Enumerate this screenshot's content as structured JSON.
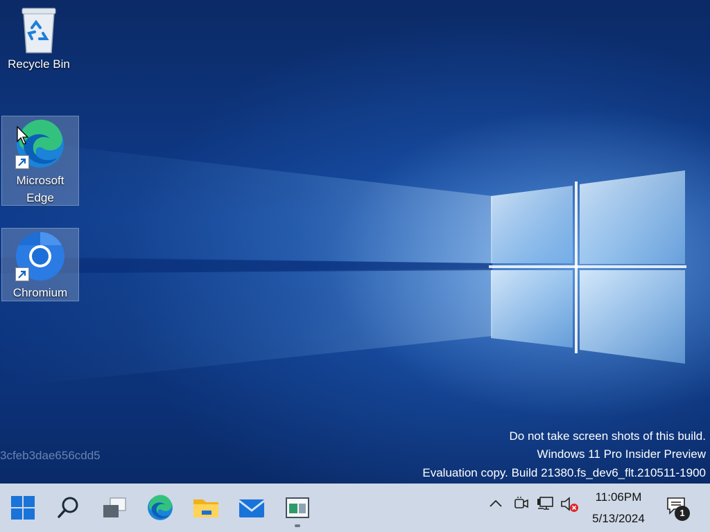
{
  "desktop": {
    "icons": [
      {
        "label": "Recycle Bin",
        "icon": "recycle-bin-icon"
      },
      {
        "label": "Microsoft Edge",
        "label_lines": [
          "Microsoft",
          "Edge"
        ],
        "icon": "edge-icon",
        "shortcut": true
      },
      {
        "label": "Chromium",
        "icon": "chromium-icon",
        "shortcut": true
      }
    ],
    "build_hash": "3cfeb3dae656cdd5",
    "watermark": [
      "Do not take screen shots of this build.",
      "Windows 11 Pro Insider Preview",
      "Evaluation copy. Build 21380.fs_dev6_flt.210511-1900"
    ]
  },
  "taskbar": {
    "apps": [
      {
        "name": "Start",
        "icon": "windows-start-icon"
      },
      {
        "name": "Search",
        "icon": "search-icon"
      },
      {
        "name": "Task View",
        "icon": "task-view-icon"
      },
      {
        "name": "Microsoft Edge",
        "icon": "edge-icon"
      },
      {
        "name": "File Explorer",
        "icon": "folder-icon"
      },
      {
        "name": "Mail",
        "icon": "mail-icon"
      },
      {
        "name": "Store",
        "icon": "store-icon",
        "active": true
      }
    ],
    "tray": {
      "icons": [
        "chevron-up-icon",
        "meet-now-icon",
        "network-icon",
        "volume-muted-icon"
      ],
      "time": "11:06PM",
      "date": "5/13/2024",
      "notification_count": "1"
    }
  },
  "colors": {
    "taskbar_bg": "#cfd8e6",
    "windows_blue": "#1a73d9",
    "mute_red": "#e0262b"
  }
}
